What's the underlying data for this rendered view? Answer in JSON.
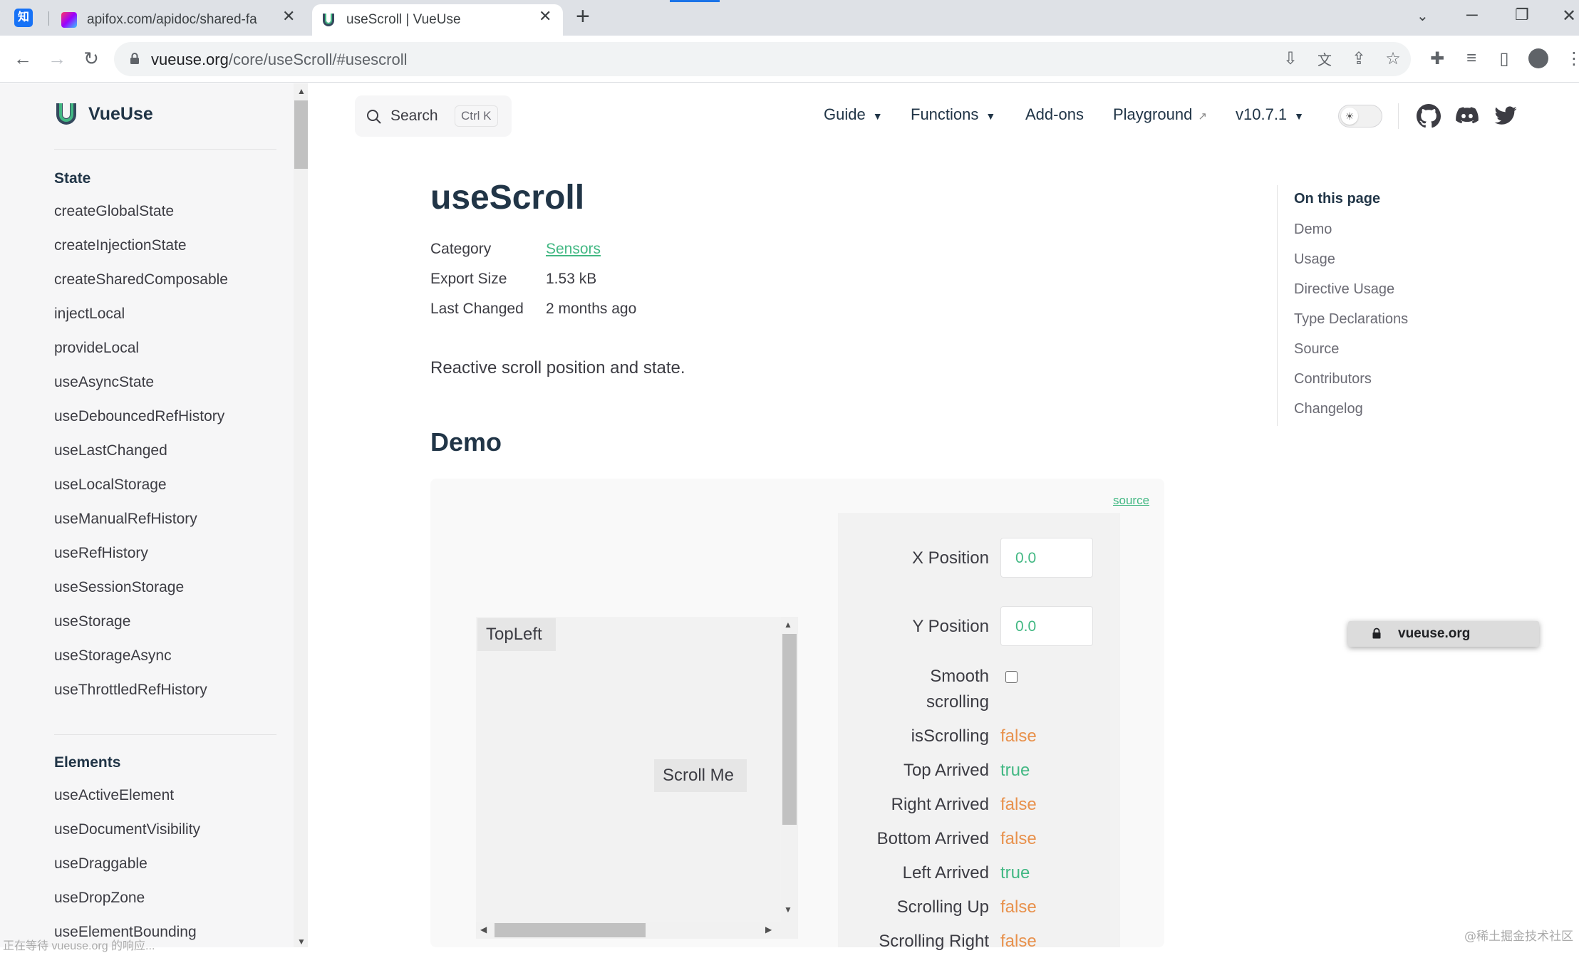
{
  "browser": {
    "tabs": [
      {
        "title": "apifox.com/apidoc/shared-fa",
        "active": false
      },
      {
        "title": "useScroll | VueUse",
        "active": true
      }
    ],
    "new_tab": "+",
    "url_host": "vueuse.org",
    "url_path": "/core/useScroll/#usescroll"
  },
  "sidebar": {
    "brand": "VueUse",
    "sections": [
      {
        "title": "State",
        "items": [
          "createGlobalState",
          "createInjectionState",
          "createSharedComposable",
          "injectLocal",
          "provideLocal",
          "useAsyncState",
          "useDebouncedRefHistory",
          "useLastChanged",
          "useLocalStorage",
          "useManualRefHistory",
          "useRefHistory",
          "useSessionStorage",
          "useStorage",
          "useStorageAsync",
          "useThrottledRefHistory"
        ]
      },
      {
        "title": "Elements",
        "items": [
          "useActiveElement",
          "useDocumentVisibility",
          "useDraggable",
          "useDropZone",
          "useElementBounding"
        ]
      }
    ]
  },
  "topnav": {
    "search_label": "Search",
    "search_kbd": "Ctrl K",
    "links": [
      "Guide",
      "Functions",
      "Add-ons",
      "Playground",
      "v10.7.1"
    ]
  },
  "page": {
    "title": "useScroll",
    "meta": [
      {
        "key": "Category",
        "value": "Sensors"
      },
      {
        "key": "Export Size",
        "value": "1.53 kB"
      },
      {
        "key": "Last Changed",
        "value": "2 months ago"
      }
    ],
    "description": "Reactive scroll position and state.",
    "demo_heading": "Demo"
  },
  "demo": {
    "source_link": "source",
    "topleft": "TopLeft",
    "scroll_me": "Scroll Me",
    "x_label": "X Position",
    "x_value": "0.0",
    "y_label": "Y Position",
    "y_value": "0.0",
    "smooth_label_1": "Smooth",
    "smooth_label_2": "scrolling",
    "states": [
      {
        "label": "isScrolling",
        "value": "false"
      },
      {
        "label": "Top Arrived",
        "value": "true"
      },
      {
        "label": "Right Arrived",
        "value": "false"
      },
      {
        "label": "Bottom Arrived",
        "value": "false"
      },
      {
        "label": "Left Arrived",
        "value": "true"
      },
      {
        "label": "Scrolling Up",
        "value": "false"
      },
      {
        "label": "Scrolling Right",
        "value": "false"
      }
    ]
  },
  "toc": {
    "heading": "On this page",
    "items": [
      "Demo",
      "Usage",
      "Directive Usage",
      "Type Declarations",
      "Source",
      "Contributors",
      "Changelog"
    ]
  },
  "tooltip": "vueuse.org",
  "status": "正在等待 vueuse.org 的响应...",
  "watermark": "@稀土掘金技术社区",
  "colors": {
    "brand": "#42b883",
    "false": "#e8914c",
    "true": "#42b883"
  }
}
